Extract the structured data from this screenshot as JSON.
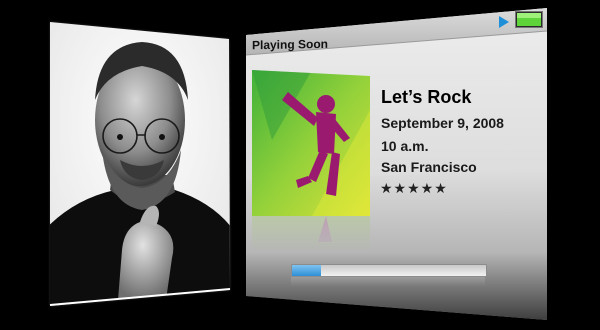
{
  "player": {
    "header_title": "Playing Soon",
    "song": {
      "title": "Let’s Rock",
      "date": "September 9, 2008",
      "time": "10 a.m.",
      "location": "San Francisco",
      "rating_text": "★★★★★",
      "rating": 5
    },
    "progress": 0.15,
    "icons": {
      "play": "play-icon",
      "battery": "battery-icon"
    }
  },
  "colors": {
    "background": "#000000",
    "panel": "#f2f2f2",
    "header": "#c7c7c7",
    "progress_fill": "#2e8fd6",
    "battery_green": "#5fd33a",
    "album_silhouette": "#9a1a70"
  }
}
